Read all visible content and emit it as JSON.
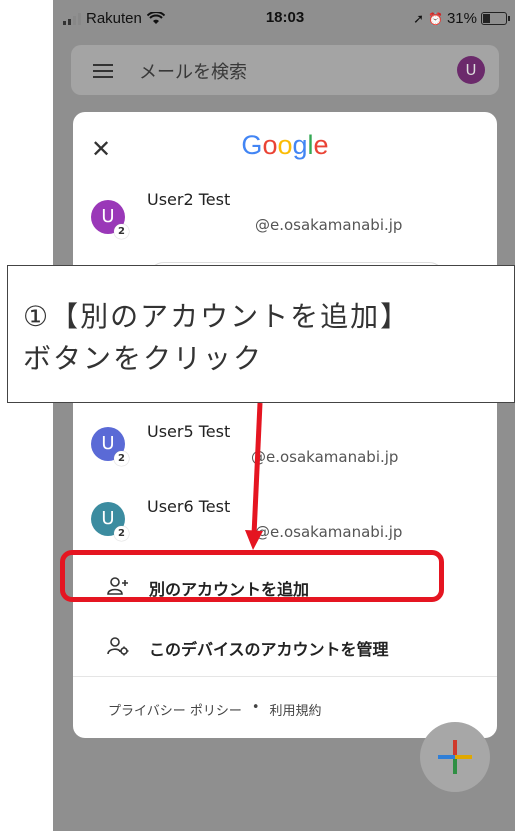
{
  "status_bar": {
    "carrier": "Rakuten",
    "time": "18:03",
    "battery": "31%"
  },
  "search": {
    "placeholder": "メールを検索",
    "avatar_letter": "U"
  },
  "account_panel": {
    "brand": "Google",
    "accounts": [
      {
        "name": "User2 Test",
        "email": "@e.osakamanabi.jp",
        "avatar_letter": "U",
        "badge": "2",
        "avatar_color": "#9a38b8"
      },
      {
        "name": "User5 Test",
        "email": "@e.osakamanabi.jp",
        "avatar_letter": "U",
        "badge": "2",
        "avatar_color": "#5a6ad6"
      },
      {
        "name": "User6 Test",
        "email": "@e.osakamanabi.jp",
        "avatar_letter": "U",
        "badge": "2",
        "avatar_color": "#3c8ca0"
      }
    ],
    "add_account_label": "別のアカウントを追加",
    "manage_accounts_label": "このデバイスのアカウントを管理",
    "privacy_label": "プライバシー ポリシー",
    "footer_separator": "•",
    "terms_label": "利用規約"
  },
  "annotation": {
    "instruction_line1": "①【別のアカウントを追加】",
    "instruction_line2": "ボタンをクリック",
    "highlight_color": "#e51521"
  }
}
